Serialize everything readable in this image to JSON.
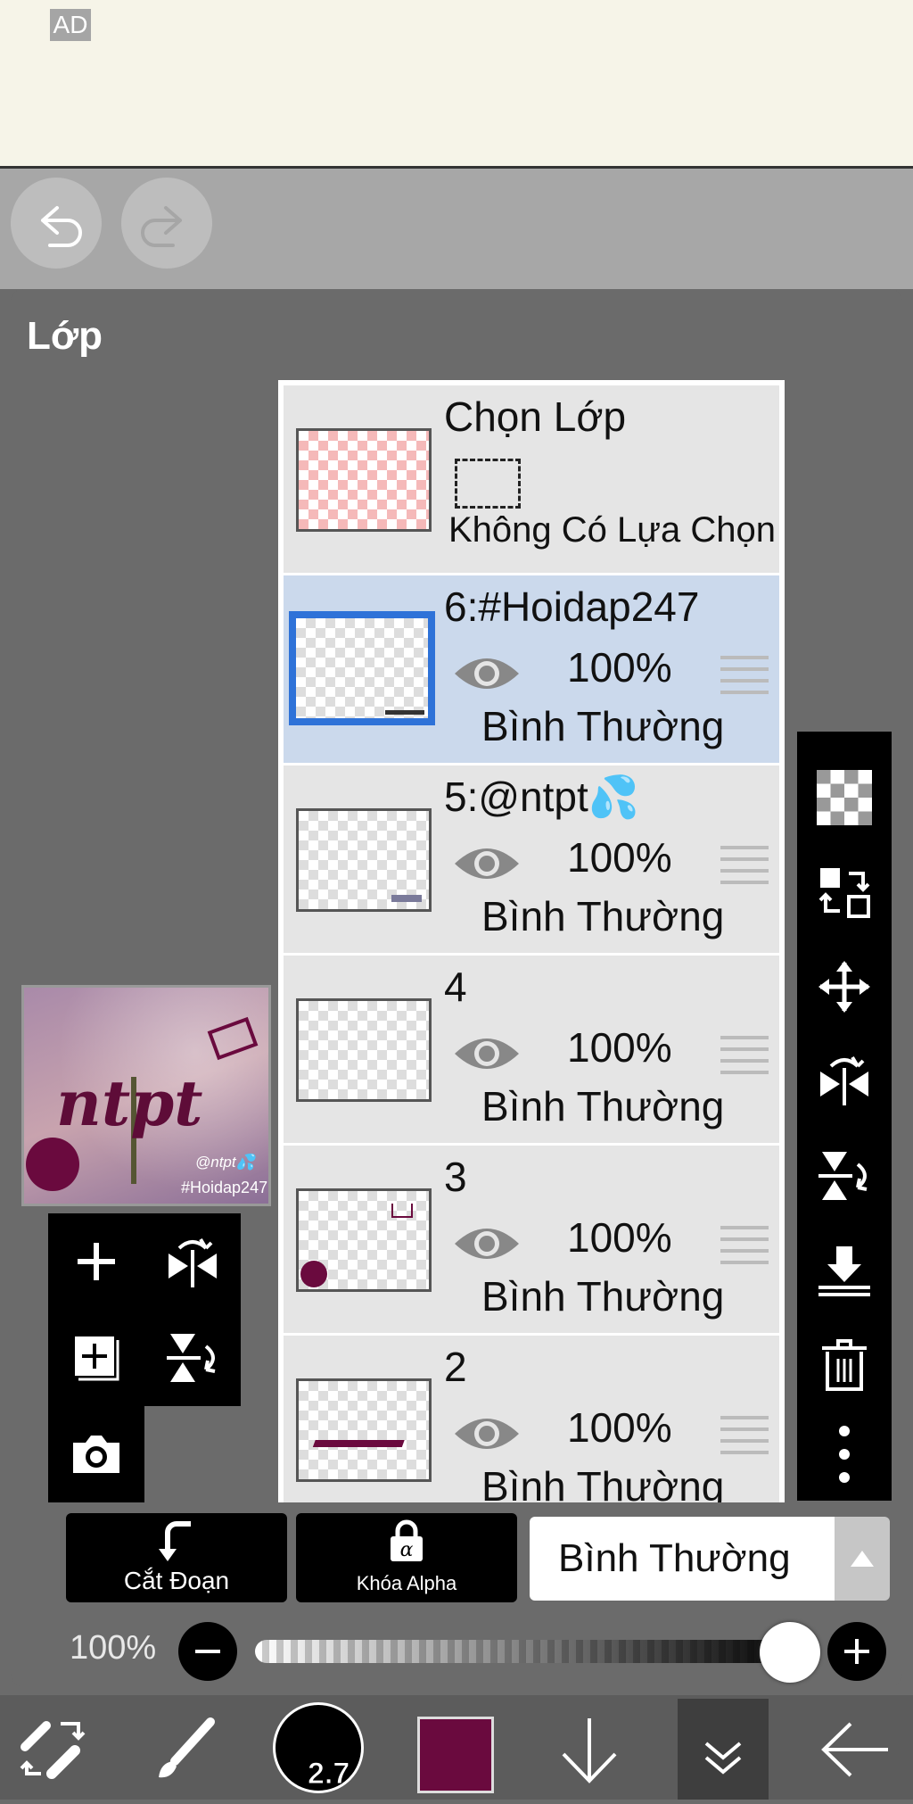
{
  "ad": {
    "tag": "AD"
  },
  "header": {
    "title": "Lớp"
  },
  "selection_row": {
    "title": "Chọn Lớp",
    "subtitle": "Không Có Lựa Chọn"
  },
  "layers": [
    {
      "name": "6:#Hoidap247",
      "opacity": "100%",
      "blend": "Bình Thường",
      "selected": true
    },
    {
      "name": "5:@ntpt💦",
      "opacity": "100%",
      "blend": "Bình Thường",
      "selected": false
    },
    {
      "name": "4",
      "opacity": "100%",
      "blend": "Bình Thường",
      "selected": false
    },
    {
      "name": "3",
      "opacity": "100%",
      "blend": "Bình Thường",
      "selected": false
    },
    {
      "name": "2",
      "opacity": "100%",
      "blend": "Bình Thường",
      "selected": false
    }
  ],
  "preview": {
    "text_main": "ntpt",
    "text_user": "@ntpt💦",
    "text_tag": "#Hoidap247"
  },
  "options": {
    "clipping_label": "Cắt Đoạn",
    "alpha_lock_label": "Khóa Alpha",
    "blend_mode": "Bình Thường"
  },
  "opacity_slider": {
    "label": "100%",
    "value": 1.0
  },
  "brush": {
    "size": "2.7",
    "color": "#6a0a3e"
  },
  "colors": {
    "accent": "#2e72d8",
    "selected_row": "#cbd9ec",
    "panel": "#6b6b6b"
  }
}
